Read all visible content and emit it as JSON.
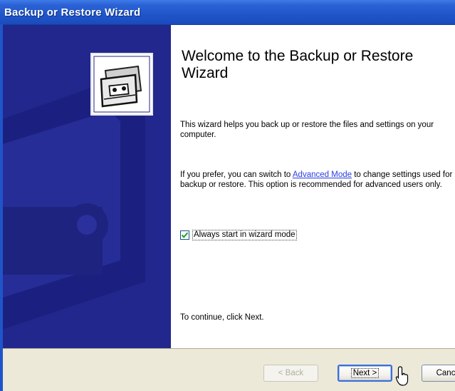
{
  "window": {
    "title": "Backup or Restore Wizard"
  },
  "welcome": {
    "heading": "Welcome to the Backup or Restore Wizard",
    "paragraph1": "This wizard helps you back up or restore the files and settings on your computer.",
    "paragraph2_prefix": "If you prefer, you can switch to ",
    "paragraph2_link": "Advanced Mode",
    "paragraph2_suffix": " to change settings used for backup or restore. This option is recommended for advanced users only.",
    "checkbox_label": "Always start in wizard mode",
    "checkbox_checked": true,
    "continue_text": "To continue, click Next."
  },
  "buttons": {
    "back": "< Back",
    "next": "Next >",
    "cancel": "Cancel"
  },
  "colors": {
    "title_bar": "#2b63d6",
    "sidebar": "#21278c",
    "footer": "#ece9d8",
    "link": "#2a3ee0"
  },
  "icons": {
    "wizard": "backup-tape-icon",
    "cursor": "pointer-cursor-icon"
  }
}
